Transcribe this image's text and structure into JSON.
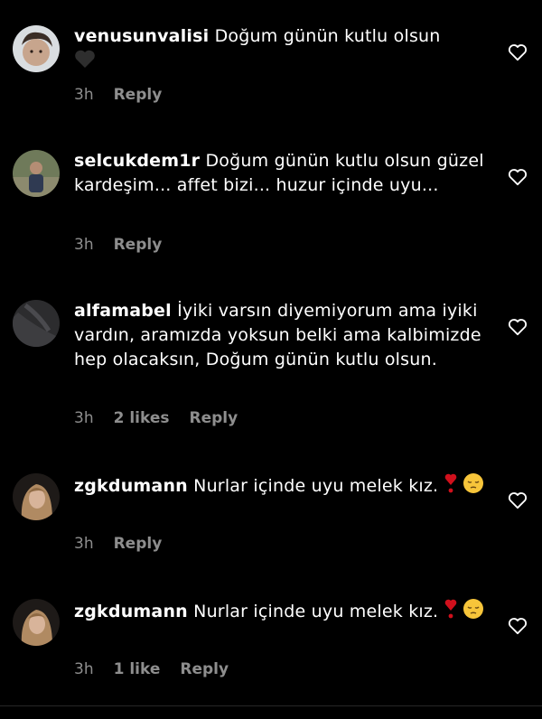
{
  "comments": [
    {
      "username": "venusunvalisi",
      "body": "Doğum günün kutlu olsun",
      "body_emoji": "black-heart",
      "time": "3h",
      "likes": "",
      "reply_label": "Reply"
    },
    {
      "username": "selcukdem1r",
      "body": "Doğum günün kutlu olsun güzel kardeşim... affet bizi... huzur içinde uyu...",
      "time": "3h",
      "likes": "",
      "reply_label": "Reply"
    },
    {
      "username": "alfamabel",
      "body": "İyiki varsın diyemiyorum ama iyiki vardın, aramızda yoksun belki ama kalbimizde hep olacaksın, Doğum günün kutlu olsun.",
      "time": "3h",
      "likes": "2 likes",
      "reply_label": "Reply"
    },
    {
      "username": "zgkdumann",
      "body": "Nurlar içinde uyu melek kız.",
      "body_emoji": [
        "heavy-exclamation-heart",
        "pensive-face"
      ],
      "time": "3h",
      "likes": "",
      "reply_label": "Reply"
    },
    {
      "username": "zgkdumann",
      "body": "Nurlar içinde uyu melek kız.",
      "body_emoji": [
        "heavy-exclamation-heart",
        "pensive-face"
      ],
      "time": "3h",
      "likes": "1 like",
      "reply_label": "Reply"
    }
  ],
  "colors": {
    "background": "#000000",
    "text": "#ffffff",
    "muted": "#8e8e8e",
    "heart_emoji": "#d0101c",
    "face_emoji": "#f7c53a"
  },
  "icons": {
    "like": "heart-outline-icon"
  }
}
